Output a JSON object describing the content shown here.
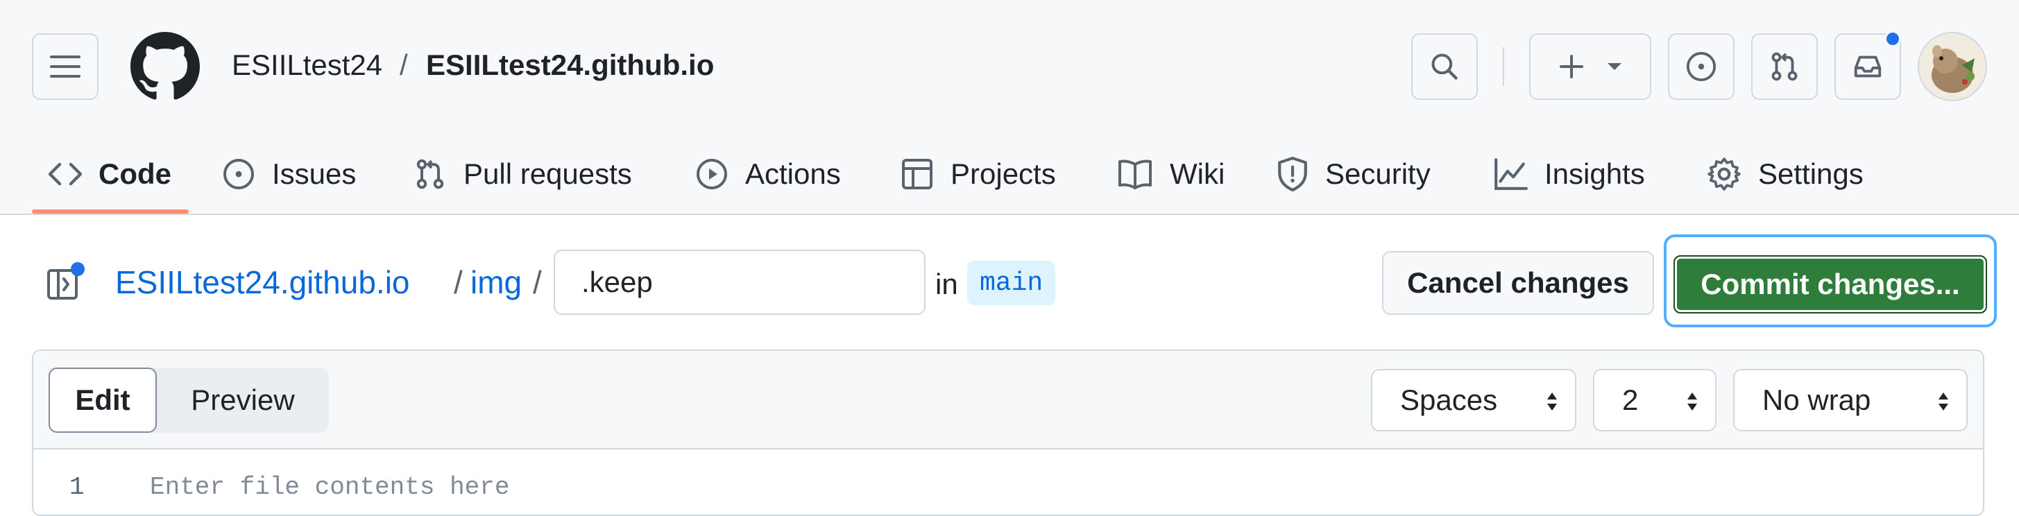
{
  "header": {
    "owner": "ESIILtest24",
    "separator": "/",
    "repo": "ESIILtest24.github.io"
  },
  "nav": {
    "tabs": [
      {
        "label": "Code",
        "icon": "code-icon",
        "selected": true
      },
      {
        "label": "Issues",
        "icon": "issue-opened-icon"
      },
      {
        "label": "Pull requests",
        "icon": "git-pull-request-icon"
      },
      {
        "label": "Actions",
        "icon": "play-icon"
      },
      {
        "label": "Projects",
        "icon": "table-icon"
      },
      {
        "label": "Wiki",
        "icon": "book-icon"
      },
      {
        "label": "Security",
        "icon": "shield-icon"
      },
      {
        "label": "Insights",
        "icon": "graph-icon"
      },
      {
        "label": "Settings",
        "icon": "gear-icon"
      }
    ]
  },
  "editor_path": {
    "repo_link": "ESIILtest24.github.io",
    "sep": "/",
    "folder_link": "img",
    "filename": ".keep",
    "in_label": "in",
    "branch": "main"
  },
  "actions": {
    "cancel": "Cancel changes",
    "commit": "Commit changes..."
  },
  "editor": {
    "tab_edit": "Edit",
    "tab_preview": "Preview",
    "indent_mode": "Spaces",
    "indent_size": "2",
    "wrap_mode": "No wrap",
    "line_number": "1",
    "placeholder": "Enter file contents here"
  },
  "colors": {
    "accent_link": "#0969da",
    "commit_green": "#2f7d3a",
    "tab_underline": "#fd8c73",
    "notification_dot": "#1f6feb"
  }
}
